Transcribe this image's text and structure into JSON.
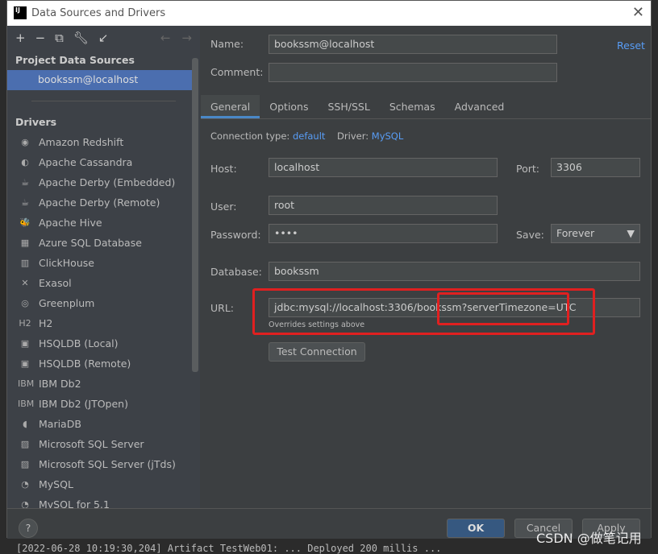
{
  "window": {
    "title": "Data Sources and Drivers",
    "logo": "IJ"
  },
  "sidebar": {
    "section_project": "Project Data Sources",
    "datasource": "bookssm@localhost",
    "section_drivers": "Drivers",
    "drivers": [
      "Amazon Redshift",
      "Apache Cassandra",
      "Apache Derby (Embedded)",
      "Apache Derby (Remote)",
      "Apache Hive",
      "Azure SQL Database",
      "ClickHouse",
      "Exasol",
      "Greenplum",
      "H2",
      "HSQLDB (Local)",
      "HSQLDB (Remote)",
      "IBM Db2",
      "IBM Db2 (JTOpen)",
      "MariaDB",
      "Microsoft SQL Server",
      "Microsoft SQL Server (jTds)",
      "MySQL",
      "MySQL for 5.1"
    ]
  },
  "form": {
    "name_label": "Name:",
    "name": "bookssm@localhost",
    "reset": "Reset",
    "comment_label": "Comment:",
    "comment": "",
    "tabs": [
      "General",
      "Options",
      "SSH/SSL",
      "Schemas",
      "Advanced"
    ],
    "conn_type_label": "Connection type:",
    "conn_type": "default",
    "driver_label": "Driver:",
    "driver": "MySQL",
    "host_label": "Host:",
    "host": "localhost",
    "port_label": "Port:",
    "port": "3306",
    "user_label": "User:",
    "user": "root",
    "password_label": "Password:",
    "password": "••••",
    "save_label": "Save:",
    "save": "Forever",
    "database_label": "Database:",
    "database": "bookssm",
    "url_label": "URL:",
    "url": "jdbc:mysql://localhost:3306/bookssm?serverTimezone=UTC",
    "url_hint": "Overrides settings above",
    "test": "Test Connection"
  },
  "footer": {
    "help": "?",
    "ok": "OK",
    "cancel": "Cancel",
    "apply": "Apply"
  },
  "console": "[2022-06-28 10:19:30,204] Artifact TestWeb01: ... Deployed 200 millis ...",
  "watermark": "CSDN @做笔记用",
  "colors": {
    "accent": "#4b6eaf",
    "highlight": "#e02020",
    "link": "#589df6"
  }
}
